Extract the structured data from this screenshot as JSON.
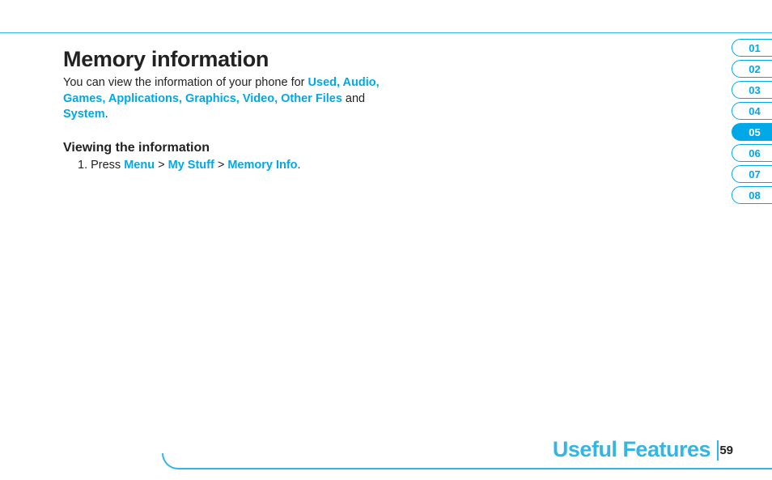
{
  "content": {
    "title": "Memory information",
    "intro_prefix": "You can view the information of your phone for ",
    "intro_highlight1": "Used, Audio, Games, Applications, Graphics, Video, Other Files",
    "intro_mid": " and ",
    "intro_highlight2": "System",
    "intro_suffix": ".",
    "subhead": "Viewing the information",
    "step_prefix": "1. Press ",
    "step_menu": "Menu",
    "step_sep1": " > ",
    "step_mystuff": "My Stuff",
    "step_sep2": " > ",
    "step_meminfo": "Memory Info",
    "step_suffix": "."
  },
  "tabs": {
    "items": [
      "01",
      "02",
      "03",
      "04",
      "05",
      "06",
      "07",
      "08"
    ],
    "active_index": 4
  },
  "footer": {
    "section": "Useful Features",
    "page": "59"
  }
}
